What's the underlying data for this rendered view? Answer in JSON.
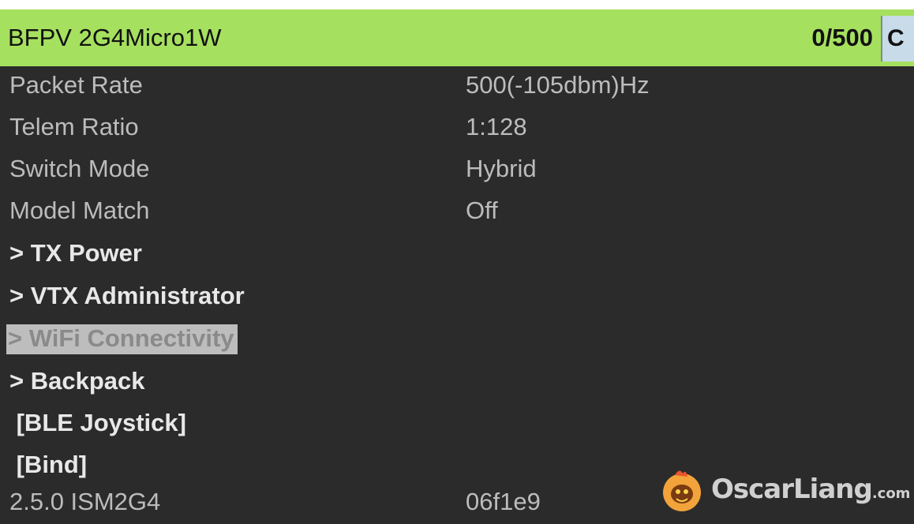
{
  "header": {
    "title": "BFPV 2G4Micro1W",
    "counter": "0/500",
    "corner_button": "C"
  },
  "rows": [
    {
      "label": "Packet Rate",
      "value": "500(-105dbm)Hz"
    },
    {
      "label": "Telem Ratio",
      "value": "1:128"
    },
    {
      "label": "Switch Mode",
      "value": "Hybrid"
    },
    {
      "label": "Model Match",
      "value": "Off"
    },
    {
      "label": "> TX Power"
    },
    {
      "label": "> VTX Administrator"
    },
    {
      "label": "> WiFi Connectivity",
      "selected": true
    },
    {
      "label": "> Backpack"
    },
    {
      "label": " [BLE Joystick]"
    },
    {
      "label": " [Bind]"
    },
    {
      "label": "2.5.0 ISM2G4",
      "value": "06f1e9"
    }
  ],
  "watermark": {
    "text": "OscarLiang",
    "suffix": ".com",
    "icon": "dragon-logo-icon"
  },
  "colors": {
    "header_bg": "#a6e05f",
    "screen_bg": "#2b2b2b",
    "text": "#bcbcbc",
    "selection_bg": "#bdbdbd"
  }
}
